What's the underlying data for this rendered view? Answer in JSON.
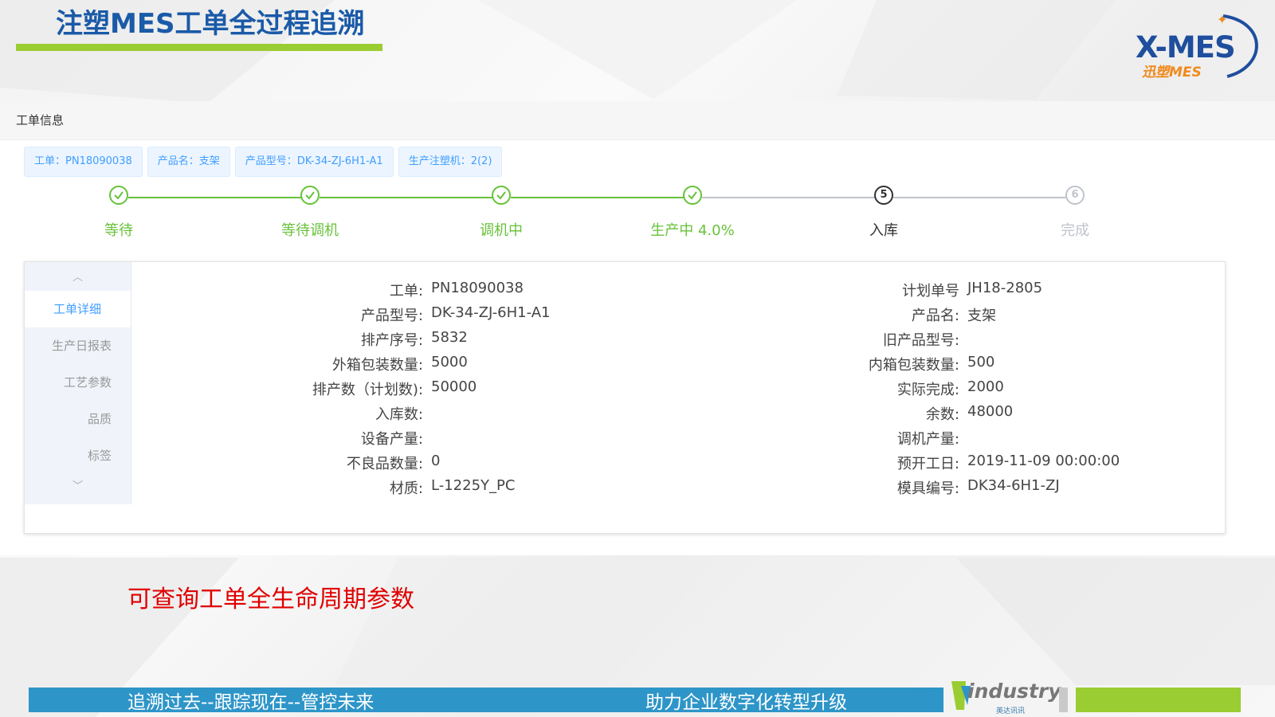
{
  "slide": {
    "title": "注塑MES工单全过程追溯",
    "caption": "可查询工单全生命周期参数"
  },
  "logo": {
    "main": "X-MES",
    "sub": "迅塑MES"
  },
  "app": {
    "header_title": "工单信息",
    "tags": [
      "工单：PN18090038",
      "产品名：支架",
      "产品型号：DK-34-ZJ-6H1-A1",
      "生产注塑机：2(2)"
    ],
    "steps": [
      {
        "label": "等待",
        "status": "finished"
      },
      {
        "label": "等待调机",
        "status": "finished"
      },
      {
        "label": "调机中",
        "status": "finished"
      },
      {
        "label": "生产中 4.0%",
        "status": "finished"
      },
      {
        "label": "入库",
        "status": "current",
        "number": "5"
      },
      {
        "label": "完成",
        "status": "wait",
        "number": "6"
      }
    ],
    "sidebar": {
      "items": [
        {
          "label": "工单详细",
          "active": true
        },
        {
          "label": "生产日报表",
          "active": false
        },
        {
          "label": "工艺参数",
          "active": false
        },
        {
          "label": "品质",
          "active": false
        },
        {
          "label": "标签",
          "active": false
        }
      ]
    },
    "details_left": [
      {
        "label": "工单:",
        "value": "PN18090038"
      },
      {
        "label": "产品型号:",
        "value": "DK-34-ZJ-6H1-A1"
      },
      {
        "label": "排产序号:",
        "value": "5832"
      },
      {
        "label": "外箱包装数量:",
        "value": "5000"
      },
      {
        "label": "排产数（计划数):",
        "value": "50000"
      },
      {
        "label": "入库数:",
        "value": ""
      },
      {
        "label": "设备产量:",
        "value": ""
      },
      {
        "label": "不良品数量:",
        "value": "0"
      },
      {
        "label": "材质:",
        "value": "L-1225Y_PC"
      }
    ],
    "details_right": [
      {
        "label": "计划单号",
        "value": "JH18-2805"
      },
      {
        "label": "产品名:",
        "value": "支架"
      },
      {
        "label": "旧产品型号:",
        "value": ""
      },
      {
        "label": "内箱包装数量:",
        "value": "500"
      },
      {
        "label": "实际完成:",
        "value": "2000"
      },
      {
        "label": "余数:",
        "value": "48000"
      },
      {
        "label": "调机产量:",
        "value": ""
      },
      {
        "label": "预开工日:",
        "value": "2019-11-09 00:00:00"
      },
      {
        "label": "模具编号:",
        "value": "DK34-6H1-ZJ"
      }
    ]
  },
  "footer": {
    "left": "追溯过去--跟踪现在--管控未来",
    "right": "助力企业数字化转型升级",
    "brand": "industry",
    "brand_sub": "英达讯讯"
  },
  "colors": {
    "primary": "#409eff",
    "success": "#67c23a",
    "title_blue": "#1a5aa8",
    "accent_green": "#9acd32",
    "footer_blue": "#2e95c8",
    "caption_red": "#e00000"
  }
}
